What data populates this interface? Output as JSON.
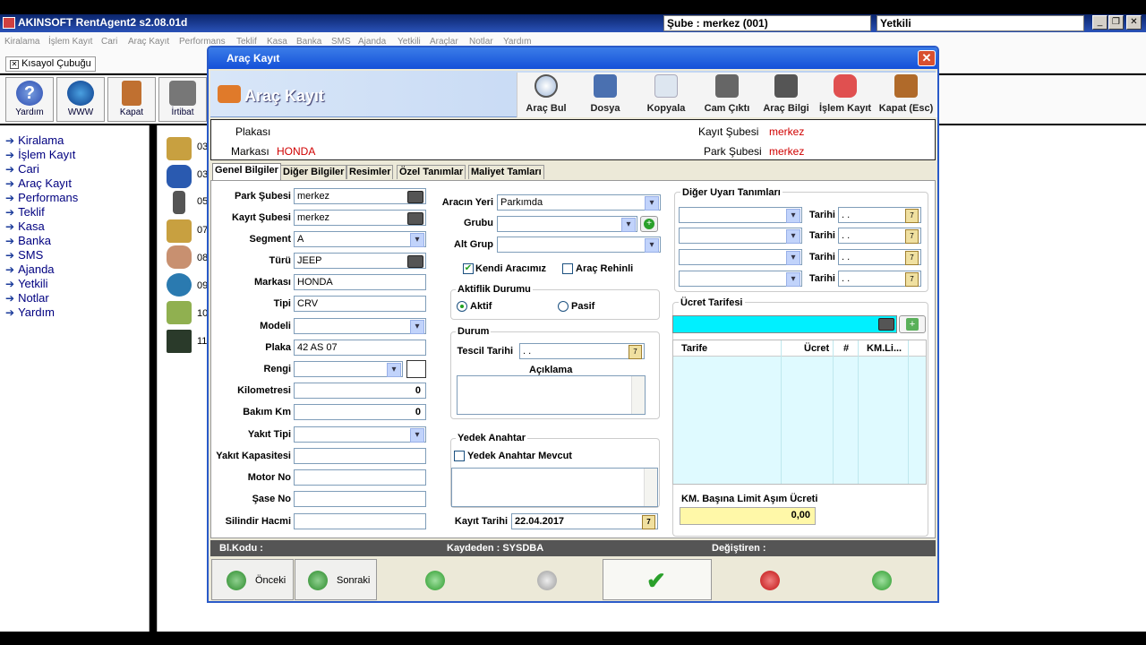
{
  "app": {
    "title": "AKINSOFT RentAgent2 s2.08.01d",
    "branch": "Şube : merkez  (001)",
    "user": "Yetkili"
  },
  "menu": [
    "Kiralama",
    "İşlem Kayıt",
    "Cari",
    "Araç Kayıt",
    "Performans",
    "Teklif",
    "Kasa",
    "Banka",
    "SMS",
    "Ajanda",
    "Yetkili",
    "Araçlar",
    "Notlar",
    "Yardım"
  ],
  "shortcut_tab": "Kısayol Çubuğu",
  "toolbar": [
    "Yardım",
    "WWW",
    "Kapat",
    "İrtibat"
  ],
  "nav": [
    "Kiralama",
    "İşlem Kayıt",
    "Cari",
    "Araç Kayıt",
    "Performans",
    "Teklif",
    "Kasa",
    "Banka",
    "SMS",
    "Ajanda",
    "Yetkili",
    "Notlar",
    "Yardım"
  ],
  "desktop_items": [
    "03",
    "03",
    "05",
    "07",
    "08",
    "09",
    "10",
    "11"
  ],
  "dialog": {
    "title": "Araç Kayıt",
    "header": "Araç Kayıt",
    "tools": [
      "Araç Bul",
      "Dosya",
      "Kopyala",
      "Cam Çıktı",
      "Araç Bilgi",
      "İşlem Kayıt",
      "Kapat (Esc)"
    ],
    "info": {
      "plaka_label": "Plakası",
      "marka_label": "Markası",
      "marka_value": "HONDA",
      "kayit_sube_label": "Kayıt Şubesi",
      "kayit_sube_value": "merkez",
      "park_sube_label": "Park Şubesi",
      "park_sube_value": "merkez"
    },
    "tabs": [
      "Genel Bilgiler",
      "Diğer Bilgiler",
      "Resimler",
      "Özel Tanımlar",
      "Maliyet Tamları"
    ],
    "left_fields": [
      {
        "label": "Park Şubesi",
        "value": "merkez"
      },
      {
        "label": "Kayıt Şubesi",
        "value": "merkez"
      },
      {
        "label": "Segment",
        "value": "A"
      },
      {
        "label": "Türü",
        "value": "JEEP"
      },
      {
        "label": "Markası",
        "value": "HONDA"
      },
      {
        "label": "Tipi",
        "value": "CRV"
      },
      {
        "label": "Modeli",
        "value": ""
      },
      {
        "label": "Plaka",
        "value": "42 AS 07"
      },
      {
        "label": "Rengi",
        "value": ""
      },
      {
        "label": "Kilometresi",
        "value": "0"
      },
      {
        "label": "Bakım Km",
        "value": "0"
      },
      {
        "label": "Yakıt Tipi",
        "value": ""
      },
      {
        "label": "Yakıt Kapasitesi",
        "value": ""
      },
      {
        "label": "Motor No",
        "value": ""
      },
      {
        "label": "Şase No",
        "value": ""
      },
      {
        "label": "Silindir Hacmi",
        "value": ""
      }
    ],
    "middle": {
      "yeri_label": "Aracın Yeri",
      "yeri_value": "Parkımda",
      "grubu_label": "Grubu",
      "altgrup_label": "Alt Grup",
      "kendi_label": "Kendi Aracımız",
      "rehin_label": "Araç Rehinli",
      "aktiflik_title": "Aktiflik Durumu",
      "aktif_label": "Aktif",
      "pasif_label": "Pasif",
      "durum_title": "Durum",
      "tescil_label": "Tescil Tarihi",
      "tescil_value": ". .",
      "aciklama_label": "Açıklama",
      "yedek_title": "Yedek Anahtar",
      "yedek_label": "Yedek Anahtar Mevcut",
      "kayit_tarihi_label": "Kayıt Tarihi",
      "kayit_tarihi_value": "22.04.2017"
    },
    "right": {
      "uyari_title": "Diğer Uyarı Tanımları",
      "tarihi_label": "Tarihi",
      "tarihi_value": ". .",
      "ucret_title": "Ücret Tarifesi",
      "cols": [
        "Tarife",
        "Ücret",
        "#",
        "KM.Li..."
      ],
      "km_label": "KM.  Başına Limit Aşım Ücreti",
      "km_value": "0,00"
    },
    "status": {
      "blkodu": "Bl.Kodu :",
      "kaydeden": "Kaydeden : SYSDBA",
      "degistiren": "Değiştiren :"
    },
    "buttons": {
      "prev": "Önceki",
      "next": "Sonraki"
    }
  }
}
